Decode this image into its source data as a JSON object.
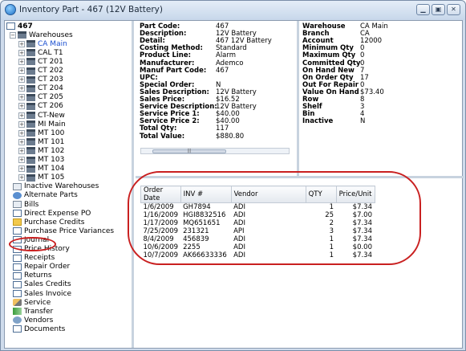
{
  "window": {
    "title": "Inventory Part - 467 (12V Battery)"
  },
  "tree": {
    "root": "467",
    "warehouses_label": "Warehouses",
    "warehouses": [
      "CA Main",
      "CAL T1",
      "CT 201",
      "CT 202",
      "CT 203",
      "CT 204",
      "CT 205",
      "CT 206",
      "CT-New",
      "MI Main",
      "MT 100",
      "MT 101",
      "MT 102",
      "MT 103",
      "MT 104",
      "MT 105"
    ],
    "items": [
      "Inactive Warehouses",
      "Alternate Parts",
      "Bills",
      "Direct Expense PO",
      "Purchase Credits",
      "Purchase Price Variances",
      "Journal",
      "Price History",
      "Receipts",
      "Repair Order",
      "Returns",
      "Sales Credits",
      "Sales Invoice",
      "Service",
      "Transfer",
      "Vendors",
      "Documents"
    ]
  },
  "details": [
    {
      "k": "Part Code:",
      "v": "467"
    },
    {
      "k": "Description:",
      "v": "12V Battery"
    },
    {
      "k": "Detail:",
      "v": "467 12V Battery"
    },
    {
      "k": "Costing Method:",
      "v": "Standard"
    },
    {
      "k": "Product Line:",
      "v": "Alarm"
    },
    {
      "k": "Manufacturer:",
      "v": "Ademco"
    },
    {
      "k": "Manuf Part Code:",
      "v": "467"
    },
    {
      "k": "UPC:",
      "v": ""
    },
    {
      "k": "Special Order:",
      "v": "N"
    },
    {
      "k": "Sales Description:",
      "v": "12V Battery"
    },
    {
      "k": "Sales Price:",
      "v": "$16.52"
    },
    {
      "k": "Service Description:",
      "v": "12V Battery"
    },
    {
      "k": "Service Price 1:",
      "v": "$40.00"
    },
    {
      "k": "Service Price 2:",
      "v": "$40.00"
    },
    {
      "k": "Total Qty:",
      "v": "117"
    },
    {
      "k": "Total Value:",
      "v": "$880.80"
    }
  ],
  "warehouse": [
    {
      "k": "Warehouse",
      "v": "CA Main"
    },
    {
      "k": "Branch",
      "v": "CA"
    },
    {
      "k": "Account",
      "v": "12000"
    },
    {
      "k": "Minimum Qty",
      "v": "0"
    },
    {
      "k": "Maximum Qty",
      "v": "0"
    },
    {
      "k": "Committed Qty",
      "v": "0"
    },
    {
      "k": "On Hand New",
      "v": "7"
    },
    {
      "k": "On Order Qty",
      "v": "17"
    },
    {
      "k": "Out For Repair",
      "v": "0"
    },
    {
      "k": "Value On Hand",
      "v": "$73.40"
    },
    {
      "k": "Row",
      "v": "8"
    },
    {
      "k": "Shelf",
      "v": "3"
    },
    {
      "k": "Bin",
      "v": "4"
    },
    {
      "k": "Inactive",
      "v": "N"
    }
  ],
  "history": {
    "columns": [
      "Order Date",
      "INV #",
      "Vendor",
      "QTY",
      "Price/Unit"
    ],
    "rows": [
      [
        "1/6/2009",
        "GH7894",
        "ADI",
        "1",
        "$7.34"
      ],
      [
        "1/16/2009",
        "HGI8832516",
        "ADI",
        "25",
        "$7.00"
      ],
      [
        "1/17/2009",
        "MQ651651",
        "ADI",
        "2",
        "$7.34"
      ],
      [
        "7/25/2009",
        "231321",
        "API",
        "3",
        "$7.34"
      ],
      [
        "8/4/2009",
        "456839",
        "ADI",
        "1",
        "$7.34"
      ],
      [
        "10/6/2009",
        "2255",
        "ADI",
        "1",
        "$0.00"
      ],
      [
        "10/7/2009",
        "AK66633336",
        "ADI",
        "1",
        "$7.34"
      ]
    ]
  },
  "colors": {
    "annotation": "#c92020",
    "link": "#1a4fd0"
  }
}
